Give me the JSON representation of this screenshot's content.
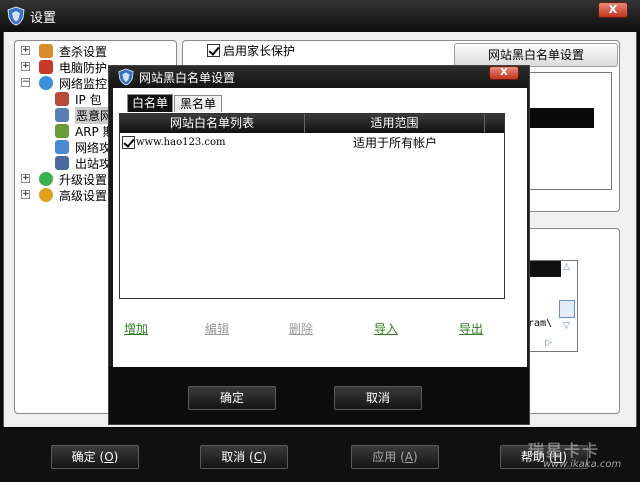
{
  "window": {
    "title": "设置",
    "close_label": "X"
  },
  "tree": {
    "items": [
      {
        "label": "查杀设置",
        "expander": "+",
        "icon_color": "#d98c2a"
      },
      {
        "label": "电脑防护",
        "expander": "+",
        "icon_color": "#c8392a"
      },
      {
        "label": "网络监控",
        "expander": "−",
        "icon_color": "#3a8fd6"
      },
      {
        "label": "IP 包",
        "icon_color": "#b84a3a"
      },
      {
        "label": "恶意网",
        "icon_color": "#5a7fb8",
        "selected": true
      },
      {
        "label": "ARP 欺",
        "icon_color": "#6a9a3a"
      },
      {
        "label": "网络攻",
        "icon_color": "#4a8ad0"
      },
      {
        "label": "出站攻",
        "icon_color": "#4a6aa0"
      },
      {
        "label": "升级设置",
        "expander": "+",
        "icon_color": "#3ab050"
      },
      {
        "label": "高级设置",
        "expander": "+",
        "icon_color": "#e0a020"
      }
    ]
  },
  "parental": {
    "checkbox_label": "启用家长保护",
    "checked": true
  },
  "blacklist_button_label": "网站黑白名单设置",
  "background_text": "gram\\",
  "dialog": {
    "title": "网站黑白名单设置",
    "close_label": "X",
    "tabs": [
      {
        "label": "白名单",
        "active": true
      },
      {
        "label": "黑名单",
        "active": false
      }
    ],
    "columns": [
      "网站白名单列表",
      "适用范围"
    ],
    "rows": [
      {
        "checked": true,
        "url": "www.hao123.com",
        "scope": "适用于所有帐户"
      }
    ],
    "actions": [
      {
        "label": "增加",
        "enabled": true
      },
      {
        "label": "编辑",
        "enabled": false
      },
      {
        "label": "删除",
        "enabled": false
      },
      {
        "label": "导入",
        "enabled": true
      },
      {
        "label": "导出",
        "enabled": true
      }
    ],
    "ok_label": "确定",
    "cancel_label": "取消"
  },
  "footer": {
    "ok_label": "确定",
    "ok_key": "O",
    "cancel_label": "取消",
    "cancel_key": "C",
    "apply_label": "应用",
    "apply_key": "A",
    "help_label": "帮助",
    "help_key": "H"
  },
  "watermark": {
    "brand": "瑞星卡卡",
    "url": "www.ikaka.com"
  },
  "colors": {
    "accent_green": "#2b7b1a",
    "close_red": "#c0361d",
    "chrome_dark": "#141414"
  }
}
